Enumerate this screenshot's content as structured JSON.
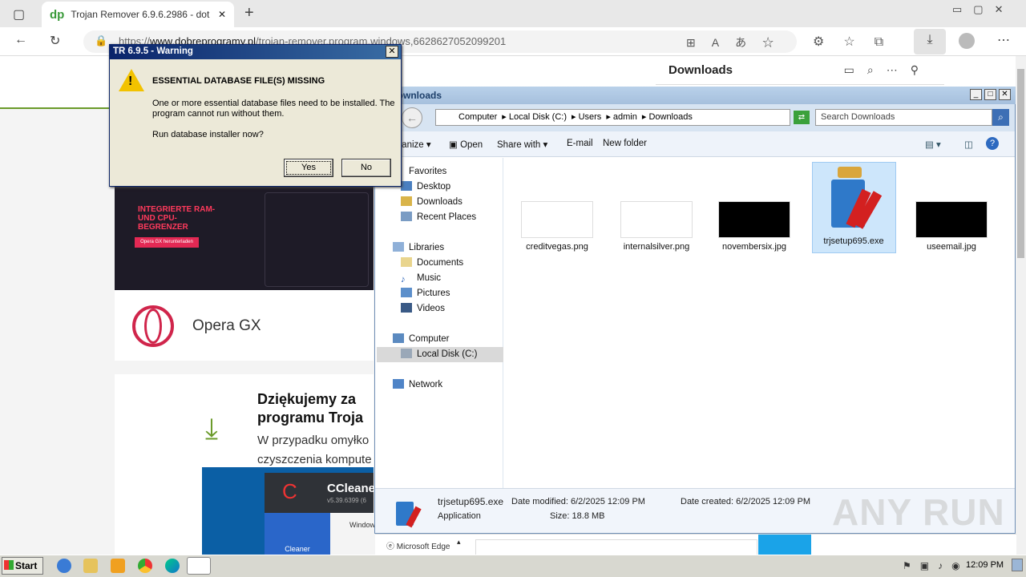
{
  "browser": {
    "tab_title": "Trojan Remover 6.9.6.2986 - dot",
    "tab_favicon": "dp",
    "url_prefix": "https://",
    "url_domain": "www.dobreprogramy.pl",
    "url_path": "/trojan-remover,program,windows,6628627052099201",
    "downloads_panel_title": "Downloads"
  },
  "page": {
    "banner_text": "INTEGRIERTE RAM- UND CPU-BEGRENZER",
    "banner_button": "Opera GX herunterladen",
    "opera_name": "Opera GX",
    "thanks_title_1": "Dziękujemy za",
    "thanks_title_2": "programu Troja",
    "thanks_line_1": "W przypadku omyłko",
    "thanks_line_2": "czyszczenia kompute",
    "ccleaner_name": "CCleane",
    "ccleaner_version": "v5.39.6399 (6",
    "ccleaner_side": "Cleaner",
    "ccleaner_window": "Window",
    "edge_item": "Microsoft Edge"
  },
  "dialog": {
    "title": "TR 6.9.5 - Warning",
    "heading": "ESSENTIAL DATABASE FILE(S) MISSING",
    "message": "One or more essential database files need to be installed. The program cannot run without them.",
    "question": "Run database installer now?",
    "yes": "Yes",
    "no": "No"
  },
  "explorer": {
    "title": "Downloads",
    "path": [
      "Computer",
      "Local Disk (C:)",
      "Users",
      "admin",
      "Downloads"
    ],
    "search_placeholder": "Search Downloads",
    "toolbar": {
      "organize": "Organize",
      "open": "Open",
      "share": "Share with",
      "email": "E-mail",
      "new_folder": "New folder"
    },
    "nav": {
      "favorites": "Favorites",
      "desktop": "Desktop",
      "downloads": "Downloads",
      "recent": "Recent Places",
      "libraries": "Libraries",
      "documents": "Documents",
      "music": "Music",
      "pictures": "Pictures",
      "videos": "Videos",
      "computer": "Computer",
      "local_disk": "Local Disk (C:)",
      "network": "Network"
    },
    "files": [
      "creditvegas.png",
      "internalsilver.png",
      "novembersix.jpg",
      "trjsetup695.exe",
      "useemail.jpg"
    ],
    "details": {
      "name": "trjsetup695.exe",
      "type": "Application",
      "modified_label": "Date modified:",
      "modified": "6/2/2025 12:09 PM",
      "created_label": "Date created:",
      "created": "6/2/2025 12:09 PM",
      "size_label": "Size:",
      "size": "18.8 MB"
    }
  },
  "taskbar": {
    "start": "Start",
    "clock": "12:09 PM"
  },
  "watermark": "ANY RUN"
}
